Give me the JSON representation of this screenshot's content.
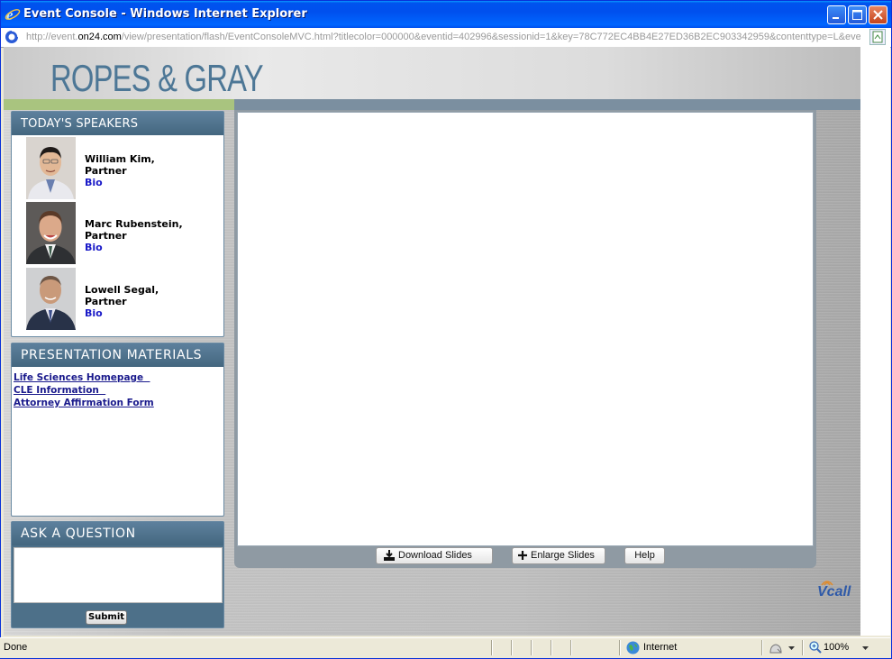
{
  "window": {
    "title": "Event Console - Windows Internet Explorer",
    "url_prefix": "http://event.",
    "url_domain": "on24.com",
    "url_rest": "/view/presentation/flash/EventConsoleMVC.html?titlecolor=000000&eventid=402996&sessionid=1&key=78C772EC4BB4E27ED36B2EC903342959&contenttype=L&eventi"
  },
  "header": {
    "logo": "ROPES & GRAY"
  },
  "speakers": {
    "heading": "TODAY'S SPEAKERS",
    "items": [
      {
        "name": "William Kim,",
        "role": "Partner",
        "bio": "Bio"
      },
      {
        "name": "Marc Rubenstein,",
        "role": "Partner",
        "bio": "Bio"
      },
      {
        "name": "Lowell Segal,",
        "role": "Partner",
        "bio": "Bio"
      }
    ]
  },
  "materials": {
    "heading": "PRESENTATION MATERIALS",
    "links": [
      "Life Sciences Homepage  ",
      "CLE Information  ",
      "Attorney Affirmation Form"
    ]
  },
  "question": {
    "heading": "ASK A QUESTION",
    "submit": "Submit",
    "value": ""
  },
  "slides": {
    "download": "Download Slides",
    "enlarge": "Enlarge Slides",
    "help": "Help"
  },
  "brand": {
    "vcall": "Vcall"
  },
  "status": {
    "text": "Done",
    "zone": "Internet",
    "zoom": "100%"
  }
}
